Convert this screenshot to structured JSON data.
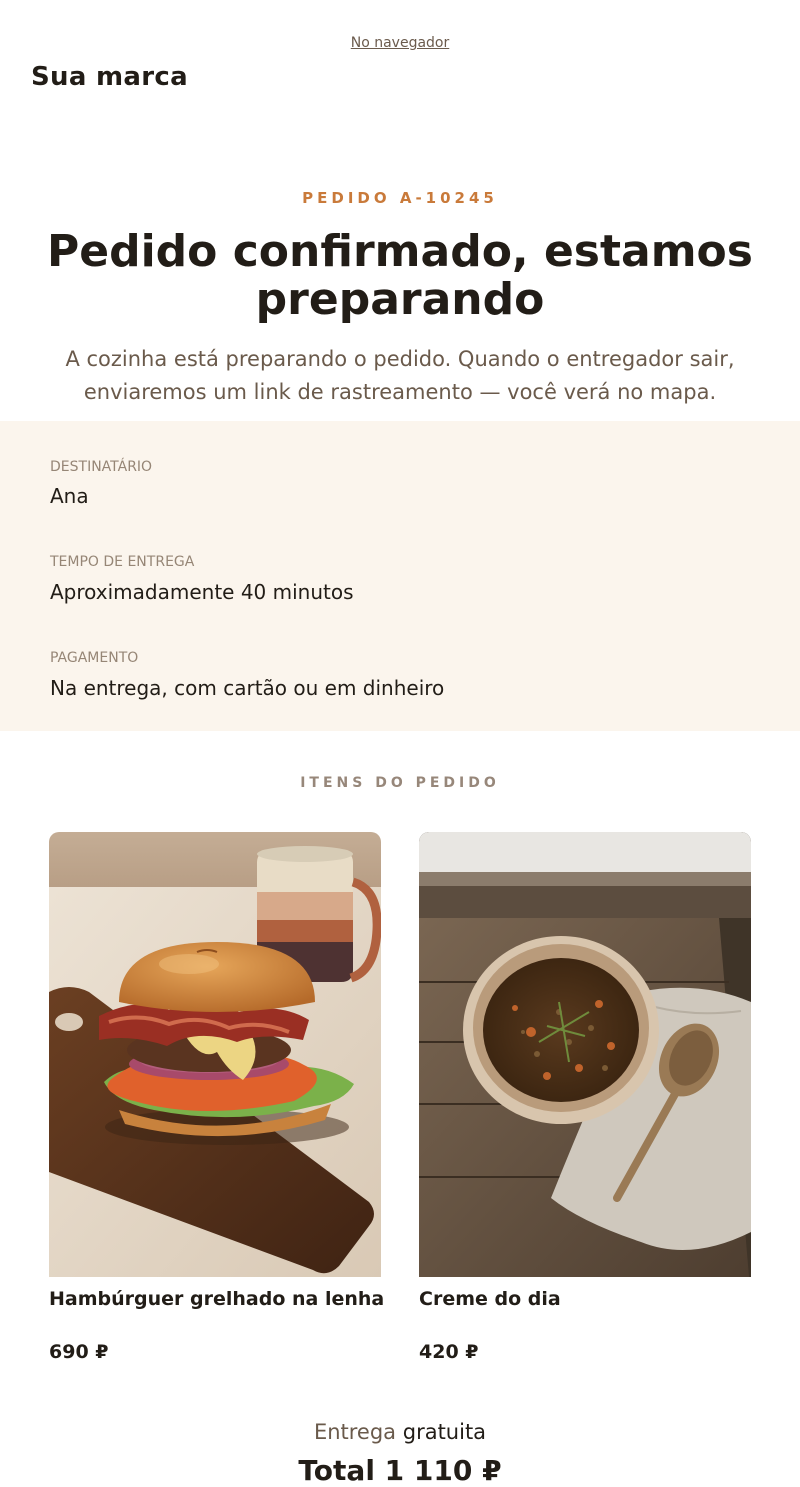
{
  "header": {
    "browser_link": "No navegador",
    "brand": "Sua marca"
  },
  "hero": {
    "order_label": "PEDIDO A-10245",
    "title": "Pedido confirmado, estamos preparando",
    "subtitle": "A cozinha está preparando o pedido. Quando o entregador sair, enviaremos um link de rastreamento — você verá no mapa."
  },
  "details": [
    {
      "label": "DESTINATÁRIO",
      "value": "Ana"
    },
    {
      "label": "TEMPO DE ENTREGA",
      "value": "Aproximadamente 40 minutos"
    },
    {
      "label": "PAGAMENTO",
      "value": "Na entrega, com cartão ou em dinheiro"
    }
  ],
  "items_section": {
    "title": "ITENS DO PEDIDO",
    "items": [
      {
        "name": "Hambúrguer grelhado na lenha",
        "price": "690 ₽",
        "image": "burger-photo"
      },
      {
        "name": "Creme do dia",
        "price": "420 ₽",
        "image": "lentil-soup-photo"
      }
    ]
  },
  "summary": {
    "delivery_label": "Entrega",
    "delivery_value": "gratuita",
    "total": "Total 1 110 ₽"
  },
  "colors": {
    "accent": "#c97a3a",
    "details_bg": "#fbf5ed",
    "text": "#221d17",
    "muted": "#6a5a4b"
  }
}
